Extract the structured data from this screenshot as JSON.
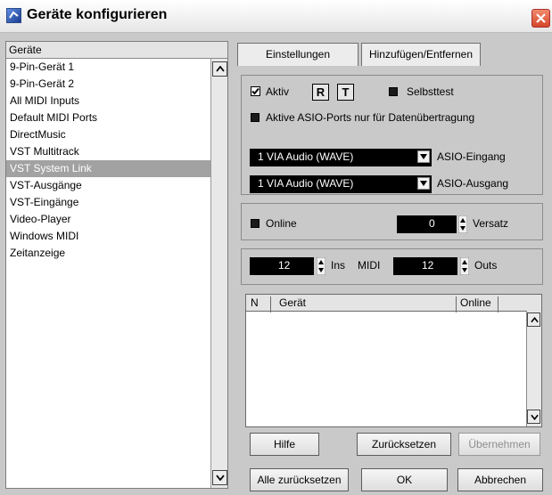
{
  "window": {
    "title": "Geräte konfigurieren"
  },
  "devices": {
    "header": "Geräte",
    "items": [
      "9-Pin-Gerät 1",
      "9-Pin-Gerät 2",
      "All MIDI Inputs",
      "Default MIDI Ports",
      "DirectMusic",
      "VST Multitrack",
      "VST System Link",
      "VST-Ausgänge",
      "VST-Eingänge",
      "Video-Player",
      "Windows MIDI",
      "Zeitanzeige"
    ],
    "selected_index": 6
  },
  "tabs": [
    "Einstellungen",
    "Hinzufügen/Entfernen"
  ],
  "settings": {
    "aktiv_label": "Aktiv",
    "aktiv_checked": true,
    "r_label": "R",
    "t_label": "T",
    "selbsttest_label": "Selbsttest",
    "asio_only_label": "Aktive ASIO-Ports nur für Datenübertragung",
    "asio_in_value": "1 VIA Audio (WAVE)",
    "asio_in_label": "ASIO-Eingang",
    "asio_out_value": "1 VIA Audio (WAVE)",
    "asio_out_label": "ASIO-Ausgang",
    "online_label": "Online",
    "versatz_value": "0",
    "versatz_label": "Versatz",
    "ins_value": "12",
    "ins_label": "Ins",
    "midi_label": "MIDI",
    "outs_value": "12",
    "outs_label": "Outs"
  },
  "table": {
    "columns": [
      "N",
      "Gerät",
      "Online"
    ]
  },
  "buttons": {
    "hilfe": "Hilfe",
    "zuruecksetzen": "Zurücksetzen",
    "uebernehmen": "Übernehmen",
    "alle_zuruecksetzen": "Alle zurücksetzen",
    "ok": "OK",
    "abbrechen": "Abbrechen"
  }
}
